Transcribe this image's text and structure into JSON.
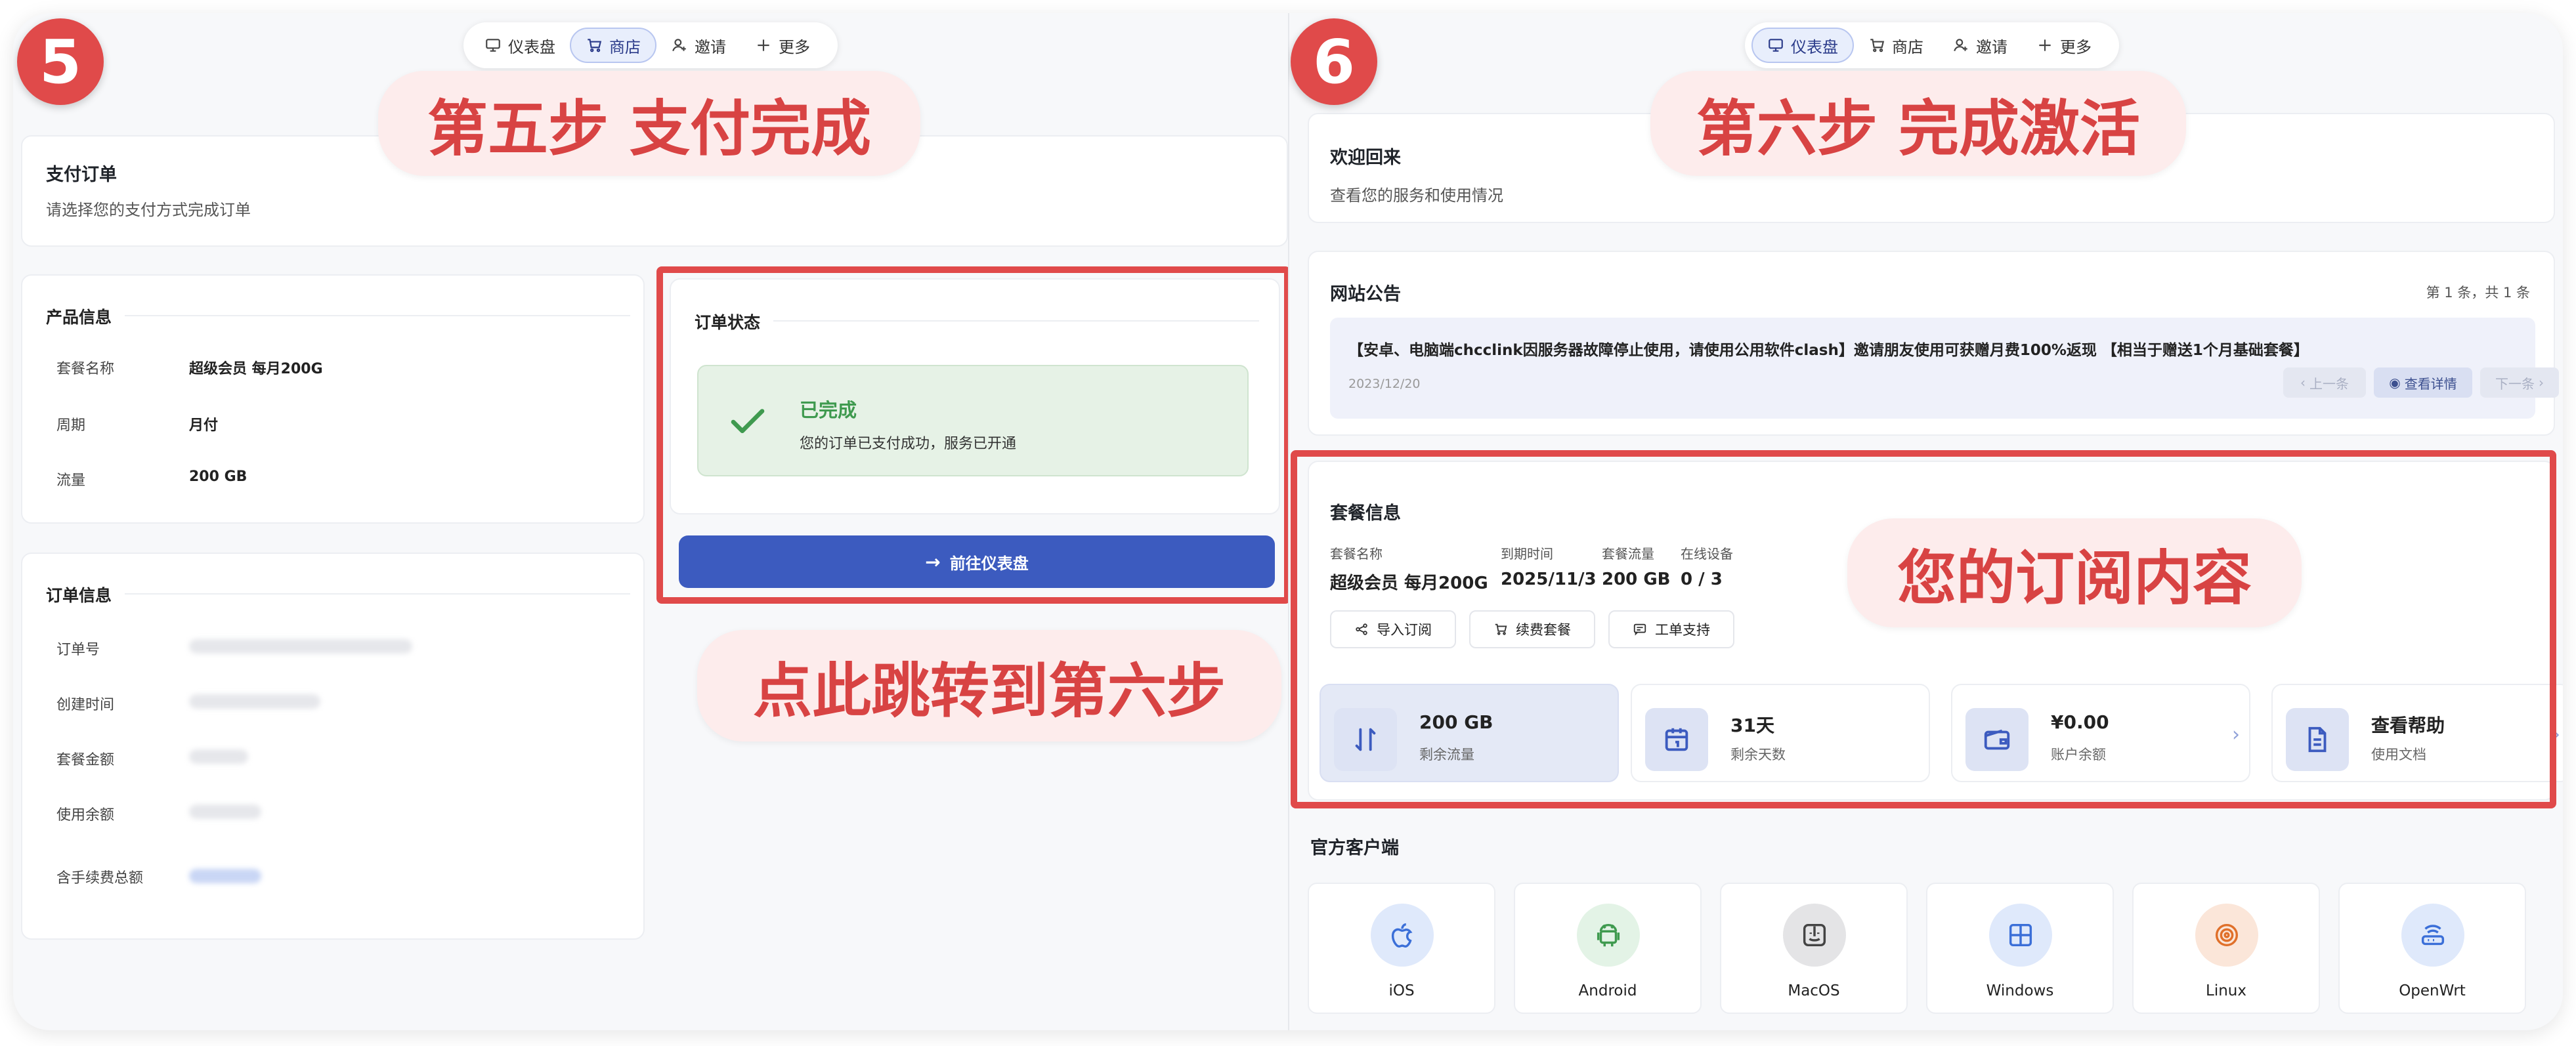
{
  "step5": {
    "badge": "5",
    "nav": [
      {
        "label": "仪表盘",
        "icon": "monitor-icon",
        "active": false
      },
      {
        "label": "商店",
        "icon": "cart-icon",
        "active": true
      },
      {
        "label": "邀请",
        "icon": "user-plus-icon",
        "active": false
      },
      {
        "label": "更多",
        "icon": "plus-icon",
        "active": false
      }
    ],
    "callout_title": "第五步 支付完成",
    "header": {
      "title": "支付订单",
      "subtitle": "请选择您的支付方式完成订单"
    },
    "product_info": {
      "title": "产品信息",
      "rows": [
        {
          "label": "套餐名称",
          "value": "超级会员 每月200G"
        },
        {
          "label": "周期",
          "value": "月付"
        },
        {
          "label": "流量",
          "value": "200 GB"
        }
      ]
    },
    "order_info": {
      "title": "订单信息",
      "rows": [
        {
          "label": "订单号"
        },
        {
          "label": "创建时间"
        },
        {
          "label": "套餐金额"
        },
        {
          "label": "使用余额"
        },
        {
          "label": "含手续费总额"
        }
      ]
    },
    "order_status": {
      "title": "订单状态",
      "status": "已完成",
      "message": "您的订单已支付成功，服务已开通"
    },
    "goto_button": "前往仪表盘",
    "callout_jump": "点此跳转到第六步"
  },
  "step6": {
    "badge": "6",
    "nav": [
      {
        "label": "仪表盘",
        "icon": "monitor-icon",
        "active": true
      },
      {
        "label": "商店",
        "icon": "cart-icon",
        "active": false
      },
      {
        "label": "邀请",
        "icon": "user-plus-icon",
        "active": false
      },
      {
        "label": "更多",
        "icon": "plus-icon",
        "active": false
      }
    ],
    "callout_title": "第六步 完成激活",
    "welcome": {
      "title": "欢迎回来",
      "subtitle": "查看您的服务和使用情况"
    },
    "announcement": {
      "title": "网站公告",
      "counter": "第 1 条，共 1 条",
      "text": "【安卓、电脑端chcclink因服务器故障停止使用，请使用公用软件clash】邀请朋友使用可获赠月费100%返现 【相当于赠送1个月基础套餐】",
      "date": "2023/12/20",
      "prev": "上一条",
      "detail": "查看详情",
      "next": "下一条"
    },
    "plan": {
      "title": "套餐信息",
      "fields": [
        {
          "label": "套餐名称",
          "value": "超级会员 每月200G"
        },
        {
          "label": "到期时间",
          "value": "2025/11/3"
        },
        {
          "label": "套餐流量",
          "value": "200 GB"
        },
        {
          "label": "在线设备",
          "value": "0 / 3"
        }
      ],
      "buttons": [
        "导入订阅",
        "续费套餐",
        "工单支持"
      ],
      "stats": [
        {
          "value": "200 GB",
          "label": "剩余流量",
          "icon": "traffic-arrows-icon"
        },
        {
          "value": "31天",
          "label": "剩余天数",
          "icon": "calendar-icon"
        },
        {
          "value": "¥0.00",
          "label": "账户余额",
          "icon": "wallet-icon"
        },
        {
          "value": "查看帮助",
          "label": "使用文档",
          "icon": "document-icon"
        }
      ]
    },
    "callout_subscription": "您的订阅内容",
    "clients": {
      "title": "官方客户端",
      "items": [
        {
          "name": "iOS",
          "icon": "apple-icon",
          "color": "#dfe9fb"
        },
        {
          "name": "Android",
          "icon": "android-icon",
          "color": "#e3f3e6"
        },
        {
          "name": "MacOS",
          "icon": "macos-icon",
          "color": "#e4e4e6"
        },
        {
          "name": "Windows",
          "icon": "windows-icon",
          "color": "#dfe9fb"
        },
        {
          "name": "Linux",
          "icon": "linux-icon",
          "color": "#fbe6d9"
        },
        {
          "name": "OpenWrt",
          "icon": "router-icon",
          "color": "#dfe9fb"
        }
      ]
    }
  },
  "colors": {
    "accent": "#3c5bbf",
    "highlight_red": "#e04a4a",
    "success_green": "#3f9a4f"
  }
}
